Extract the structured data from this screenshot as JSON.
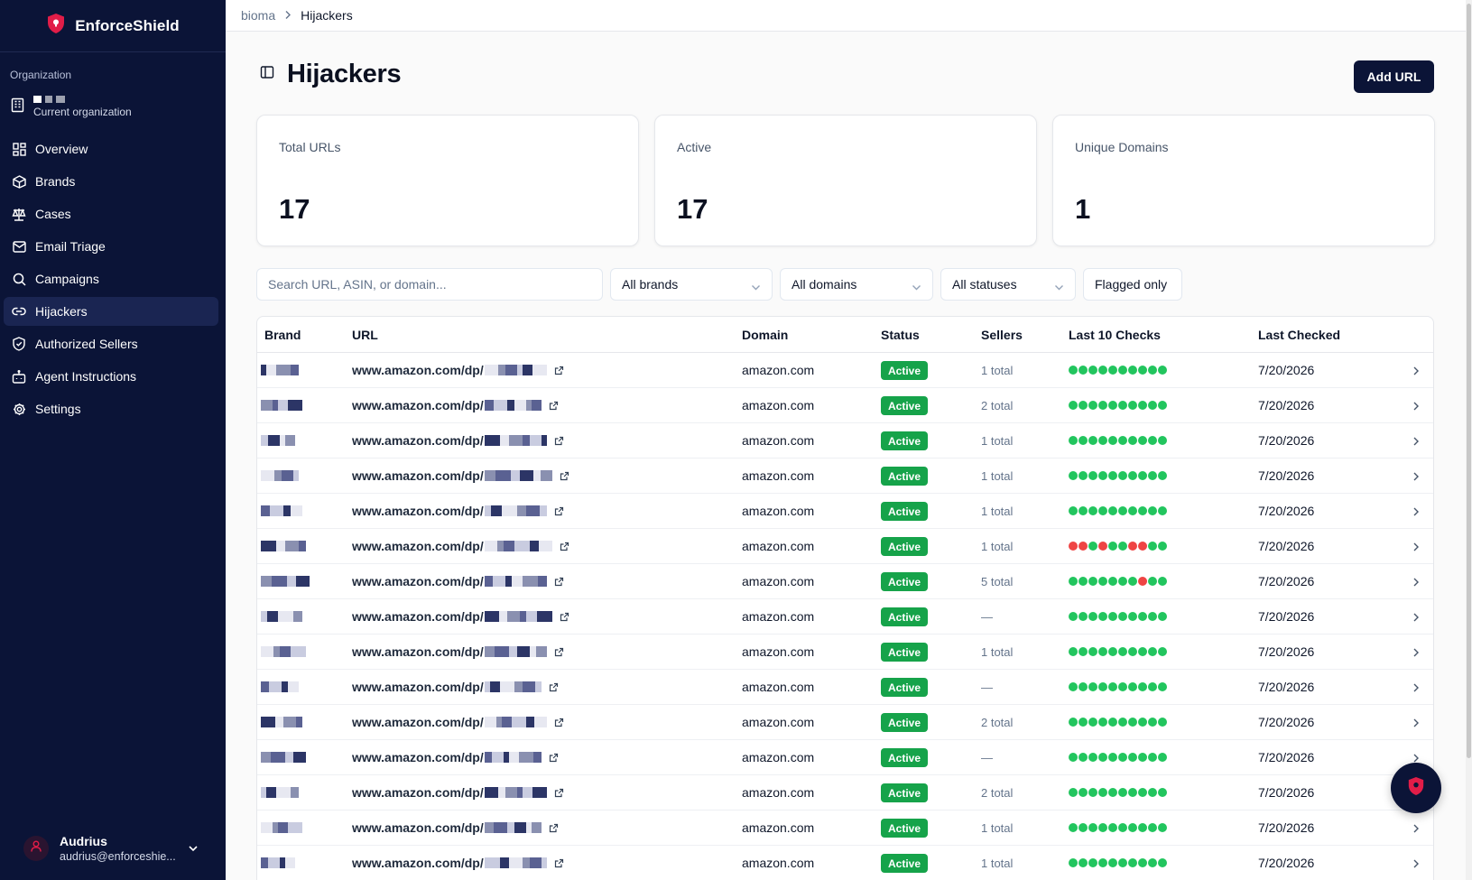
{
  "app": {
    "name": "EnforceShield"
  },
  "sidebar": {
    "org_label": "Organization",
    "org_sub": "Current organization",
    "items": [
      {
        "label": "Overview",
        "icon": "grid-icon"
      },
      {
        "label": "Brands",
        "icon": "box-icon"
      },
      {
        "label": "Cases",
        "icon": "scale-icon"
      },
      {
        "label": "Email Triage",
        "icon": "mail-icon"
      },
      {
        "label": "Campaigns",
        "icon": "search-icon"
      },
      {
        "label": "Hijackers",
        "icon": "link-icon",
        "active": true
      },
      {
        "label": "Authorized Sellers",
        "icon": "shield-check-icon"
      },
      {
        "label": "Agent Instructions",
        "icon": "bot-icon"
      },
      {
        "label": "Settings",
        "icon": "gear-icon"
      }
    ],
    "user": {
      "name": "Audrius",
      "email": "audrius@enforceshie..."
    }
  },
  "breadcrumb": {
    "parent": "bioma",
    "current": "Hijackers"
  },
  "page": {
    "title": "Hijackers",
    "add_button": "Add URL"
  },
  "stats": [
    {
      "label": "Total URLs",
      "value": "17"
    },
    {
      "label": "Active",
      "value": "17"
    },
    {
      "label": "Unique Domains",
      "value": "1"
    }
  ],
  "filters": {
    "search_placeholder": "Search URL, ASIN, or domain...",
    "brands": "All brands",
    "domains": "All domains",
    "statuses": "All statuses",
    "flagged": "Flagged only"
  },
  "table": {
    "columns": [
      "Brand",
      "URL",
      "Domain",
      "Status",
      "Sellers",
      "Last 10 Checks",
      "Last Checked"
    ],
    "colors": {
      "ok": "#22c55e",
      "fail": "#ef4444"
    },
    "rows": [
      {
        "url": "www.amazon.com/dp/",
        "domain": "amazon.com",
        "status": "Active",
        "sellers": "1 total",
        "checks": "gggggggggg",
        "last_checked": "7/20/2026"
      },
      {
        "url": "www.amazon.com/dp/",
        "domain": "amazon.com",
        "status": "Active",
        "sellers": "2 total",
        "checks": "gggggggggg",
        "last_checked": "7/20/2026"
      },
      {
        "url": "www.amazon.com/dp/",
        "domain": "amazon.com",
        "status": "Active",
        "sellers": "1 total",
        "checks": "gggggggggg",
        "last_checked": "7/20/2026"
      },
      {
        "url": "www.amazon.com/dp/",
        "domain": "amazon.com",
        "status": "Active",
        "sellers": "1 total",
        "checks": "gggggggggg",
        "last_checked": "7/20/2026"
      },
      {
        "url": "www.amazon.com/dp/",
        "domain": "amazon.com",
        "status": "Active",
        "sellers": "1 total",
        "checks": "gggggggggg",
        "last_checked": "7/20/2026"
      },
      {
        "url": "www.amazon.com/dp/",
        "domain": "amazon.com",
        "status": "Active",
        "sellers": "1 total",
        "checks": "rrgrggrrgg",
        "last_checked": "7/20/2026"
      },
      {
        "url": "www.amazon.com/dp/",
        "domain": "amazon.com",
        "status": "Active",
        "sellers": "5 total",
        "checks": "gggggggrggg",
        "last_checked": "7/20/2026"
      },
      {
        "url": "www.amazon.com/dp/",
        "domain": "amazon.com",
        "status": "Active",
        "sellers": "—",
        "checks": "gggggggggg",
        "last_checked": "7/20/2026"
      },
      {
        "url": "www.amazon.com/dp/",
        "domain": "amazon.com",
        "status": "Active",
        "sellers": "1 total",
        "checks": "gggggggggg",
        "last_checked": "7/20/2026"
      },
      {
        "url": "www.amazon.com/dp/",
        "domain": "amazon.com",
        "status": "Active",
        "sellers": "—",
        "checks": "gggggggggg",
        "last_checked": "7/20/2026"
      },
      {
        "url": "www.amazon.com/dp/",
        "domain": "amazon.com",
        "status": "Active",
        "sellers": "2 total",
        "checks": "gggggggggg",
        "last_checked": "7/20/2026"
      },
      {
        "url": "www.amazon.com/dp/",
        "domain": "amazon.com",
        "status": "Active",
        "sellers": "—",
        "checks": "gggggggggg",
        "last_checked": "7/20/2026"
      },
      {
        "url": "www.amazon.com/dp/",
        "domain": "amazon.com",
        "status": "Active",
        "sellers": "2 total",
        "checks": "gggggggggg",
        "last_checked": "7/20/2026"
      },
      {
        "url": "www.amazon.com/dp/",
        "domain": "amazon.com",
        "status": "Active",
        "sellers": "1 total",
        "checks": "gggggggggg",
        "last_checked": "7/20/2026"
      },
      {
        "url": "www.amazon.com/dp/",
        "domain": "amazon.com",
        "status": "Active",
        "sellers": "1 total",
        "checks": "gggggggggg",
        "last_checked": "7/20/2026"
      }
    ]
  }
}
